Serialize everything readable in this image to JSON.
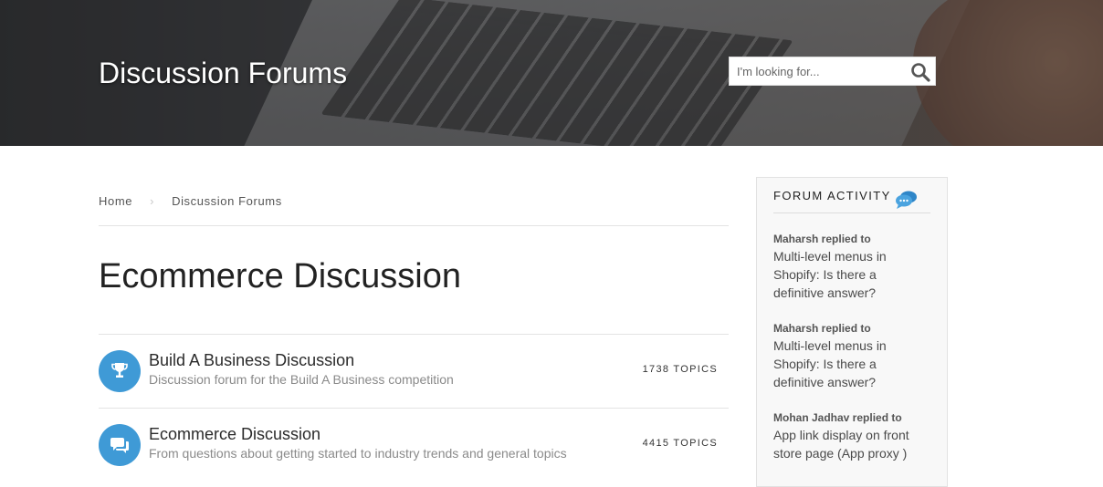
{
  "header": {
    "title": "Discussion Forums",
    "search": {
      "placeholder": "I'm looking for...",
      "value": ""
    }
  },
  "breadcrumb": {
    "items": [
      "Home",
      "Discussion Forums"
    ],
    "separator": "›"
  },
  "page": {
    "title": "Ecommerce Discussion"
  },
  "forums": [
    {
      "name": "Build A Business Discussion",
      "description": "Discussion forum for the Build A Business competition",
      "topics": "1738 TOPICS",
      "icon": "trophy-icon"
    },
    {
      "name": "Ecommerce Discussion",
      "description": "From questions about getting started to industry trends and general topics",
      "topics": "4415 TOPICS",
      "icon": "chat-bubbles-icon"
    }
  ],
  "sidebar": {
    "title": "FORUM ACTIVITY",
    "icon": "chat-bubbles-icon",
    "activity": [
      {
        "who": "Maharsh replied to",
        "topic": "Multi-level menus in Shopify: Is there a definitive answer?"
      },
      {
        "who": "Maharsh replied to",
        "topic": "Multi-level menus in Shopify: Is there a definitive answer?"
      },
      {
        "who": "Mohan Jadhav replied to",
        "topic": "App link display on front store page (App proxy )"
      }
    ]
  },
  "colors": {
    "accent": "#3f9ad6",
    "text_dark": "#222222",
    "text_muted": "#8a8a8a",
    "sidebar_bg": "#f8f8f8"
  }
}
